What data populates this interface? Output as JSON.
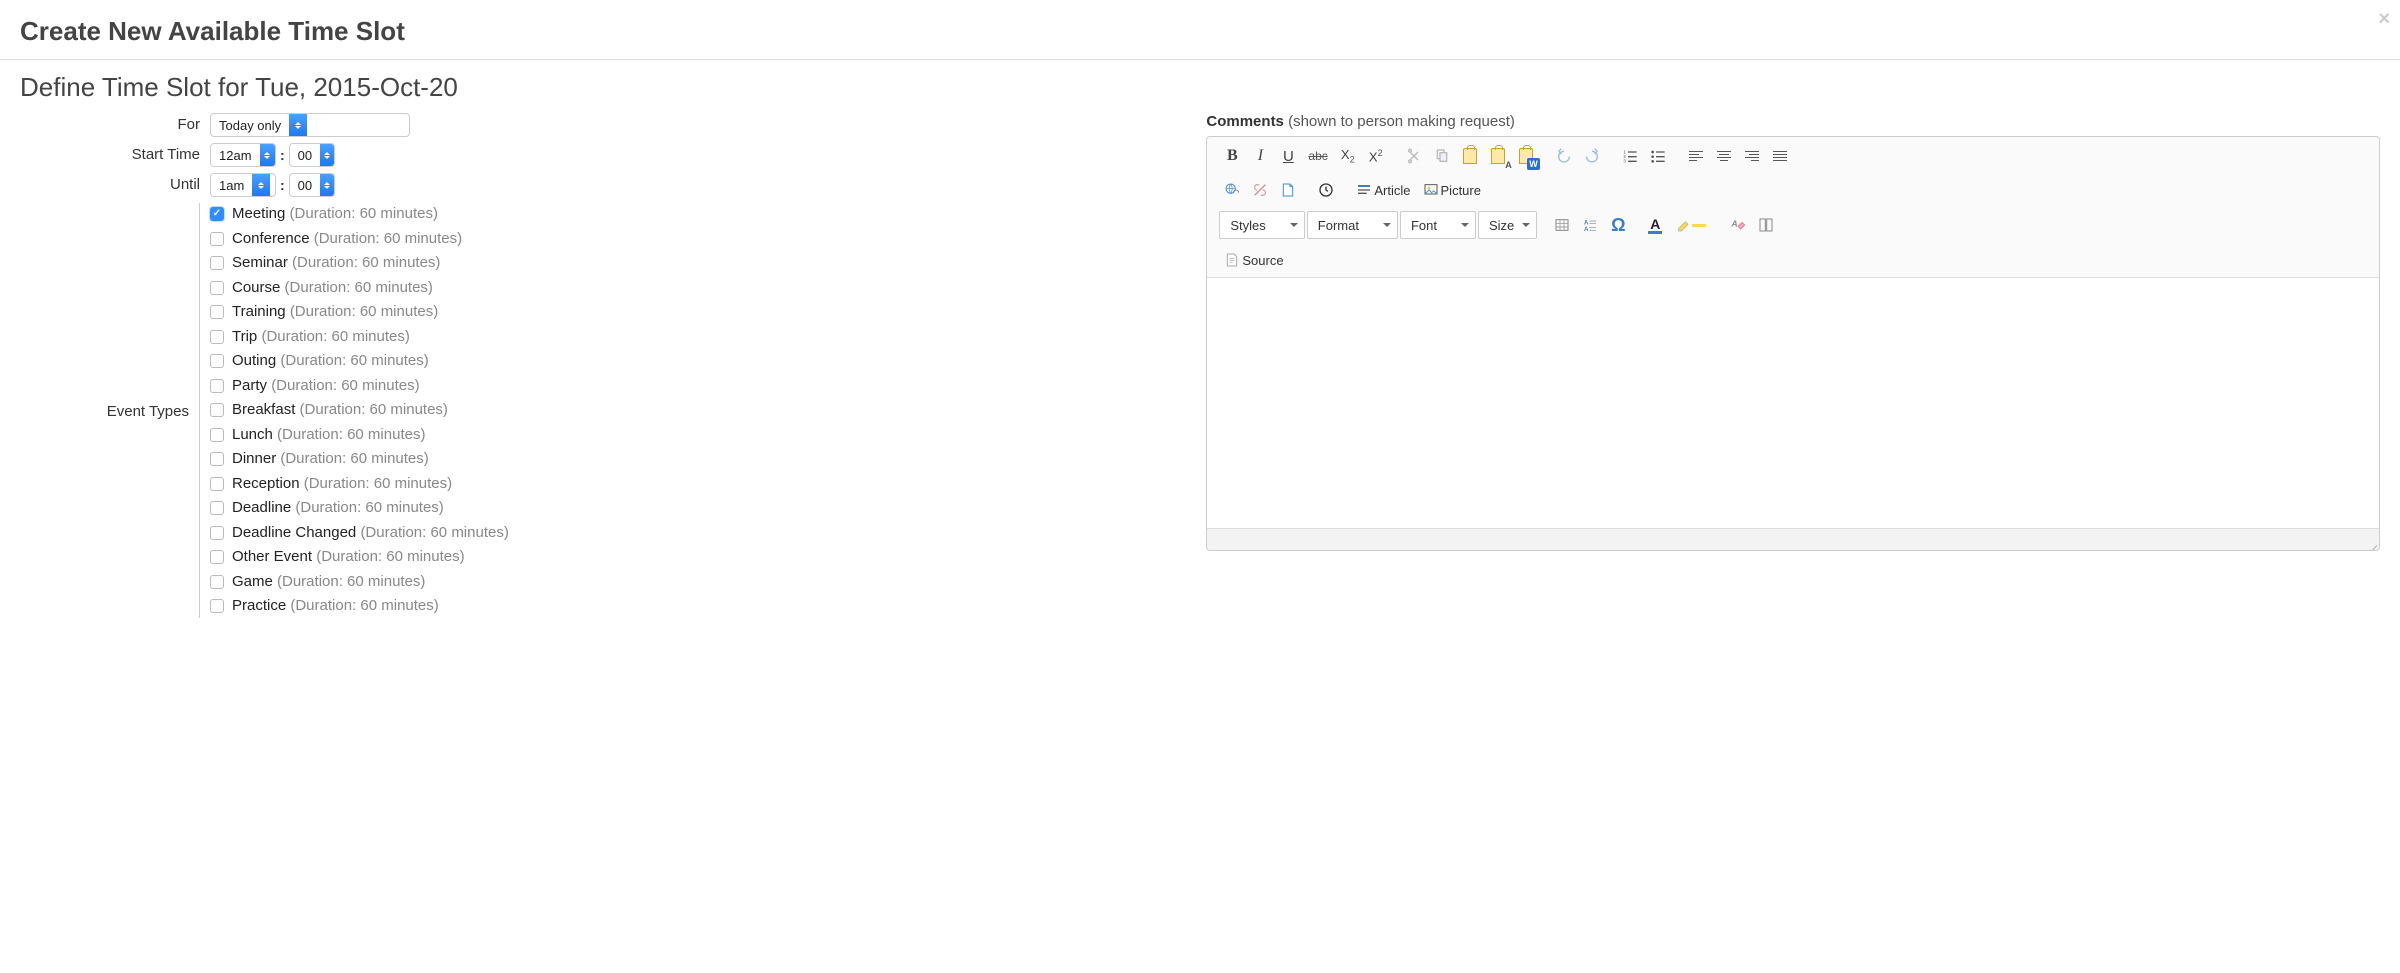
{
  "page_title": "Create New Available Time Slot",
  "subtitle": "Define Time Slot for Tue, 2015-Oct-20",
  "labels": {
    "for": "For",
    "start_time": "Start Time",
    "until": "Until",
    "event_types": "Event Types",
    "colon": ":"
  },
  "for_select": {
    "value": "Today only"
  },
  "start_time": {
    "hour": "12am",
    "minute": "00"
  },
  "until_time": {
    "hour": "1am",
    "minute": "00"
  },
  "event_types": [
    {
      "name": "Meeting",
      "duration": "(Duration: 60 minutes)",
      "checked": true
    },
    {
      "name": "Conference",
      "duration": "(Duration: 60 minutes)",
      "checked": false
    },
    {
      "name": "Seminar",
      "duration": "(Duration: 60 minutes)",
      "checked": false
    },
    {
      "name": "Course",
      "duration": "(Duration: 60 minutes)",
      "checked": false
    },
    {
      "name": "Training",
      "duration": "(Duration: 60 minutes)",
      "checked": false
    },
    {
      "name": "Trip",
      "duration": "(Duration: 60 minutes)",
      "checked": false
    },
    {
      "name": "Outing",
      "duration": "(Duration: 60 minutes)",
      "checked": false
    },
    {
      "name": "Party",
      "duration": "(Duration: 60 minutes)",
      "checked": false
    },
    {
      "name": "Breakfast",
      "duration": "(Duration: 60 minutes)",
      "checked": false
    },
    {
      "name": "Lunch",
      "duration": "(Duration: 60 minutes)",
      "checked": false
    },
    {
      "name": "Dinner",
      "duration": "(Duration: 60 minutes)",
      "checked": false
    },
    {
      "name": "Reception",
      "duration": "(Duration: 60 minutes)",
      "checked": false
    },
    {
      "name": "Deadline",
      "duration": "(Duration: 60 minutes)",
      "checked": false
    },
    {
      "name": "Deadline Changed",
      "duration": "(Duration: 60 minutes)",
      "checked": false
    },
    {
      "name": "Other Event",
      "duration": "(Duration: 60 minutes)",
      "checked": false
    },
    {
      "name": "Game",
      "duration": "(Duration: 60 minutes)",
      "checked": false
    },
    {
      "name": "Practice",
      "duration": "(Duration: 60 minutes)",
      "checked": false
    }
  ],
  "comments": {
    "label_bold": "Comments",
    "label_light": " (shown to person making request)"
  },
  "toolbar": {
    "article": "Article",
    "picture": "Picture",
    "styles": "Styles",
    "format": "Format",
    "font": "Font",
    "size": "Size",
    "source": "Source"
  }
}
